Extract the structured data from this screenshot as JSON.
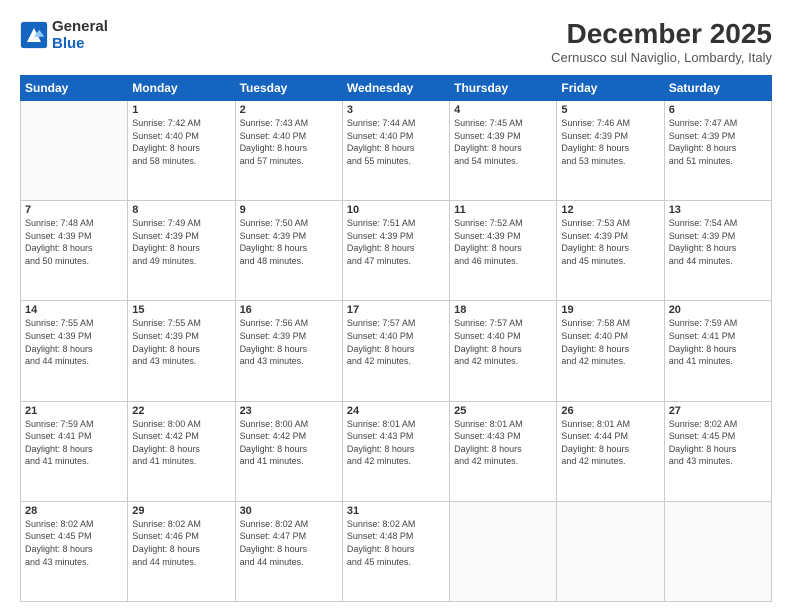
{
  "header": {
    "logo_general": "General",
    "logo_blue": "Blue",
    "title": "December 2025",
    "location": "Cernusco sul Naviglio, Lombardy, Italy"
  },
  "weekdays": [
    "Sunday",
    "Monday",
    "Tuesday",
    "Wednesday",
    "Thursday",
    "Friday",
    "Saturday"
  ],
  "weeks": [
    [
      {
        "day": "",
        "info": ""
      },
      {
        "day": "1",
        "info": "Sunrise: 7:42 AM\nSunset: 4:40 PM\nDaylight: 8 hours\nand 58 minutes."
      },
      {
        "day": "2",
        "info": "Sunrise: 7:43 AM\nSunset: 4:40 PM\nDaylight: 8 hours\nand 57 minutes."
      },
      {
        "day": "3",
        "info": "Sunrise: 7:44 AM\nSunset: 4:40 PM\nDaylight: 8 hours\nand 55 minutes."
      },
      {
        "day": "4",
        "info": "Sunrise: 7:45 AM\nSunset: 4:39 PM\nDaylight: 8 hours\nand 54 minutes."
      },
      {
        "day": "5",
        "info": "Sunrise: 7:46 AM\nSunset: 4:39 PM\nDaylight: 8 hours\nand 53 minutes."
      },
      {
        "day": "6",
        "info": "Sunrise: 7:47 AM\nSunset: 4:39 PM\nDaylight: 8 hours\nand 51 minutes."
      }
    ],
    [
      {
        "day": "7",
        "info": "Sunrise: 7:48 AM\nSunset: 4:39 PM\nDaylight: 8 hours\nand 50 minutes."
      },
      {
        "day": "8",
        "info": "Sunrise: 7:49 AM\nSunset: 4:39 PM\nDaylight: 8 hours\nand 49 minutes."
      },
      {
        "day": "9",
        "info": "Sunrise: 7:50 AM\nSunset: 4:39 PM\nDaylight: 8 hours\nand 48 minutes."
      },
      {
        "day": "10",
        "info": "Sunrise: 7:51 AM\nSunset: 4:39 PM\nDaylight: 8 hours\nand 47 minutes."
      },
      {
        "day": "11",
        "info": "Sunrise: 7:52 AM\nSunset: 4:39 PM\nDaylight: 8 hours\nand 46 minutes."
      },
      {
        "day": "12",
        "info": "Sunrise: 7:53 AM\nSunset: 4:39 PM\nDaylight: 8 hours\nand 45 minutes."
      },
      {
        "day": "13",
        "info": "Sunrise: 7:54 AM\nSunset: 4:39 PM\nDaylight: 8 hours\nand 44 minutes."
      }
    ],
    [
      {
        "day": "14",
        "info": "Sunrise: 7:55 AM\nSunset: 4:39 PM\nDaylight: 8 hours\nand 44 minutes."
      },
      {
        "day": "15",
        "info": "Sunrise: 7:55 AM\nSunset: 4:39 PM\nDaylight: 8 hours\nand 43 minutes."
      },
      {
        "day": "16",
        "info": "Sunrise: 7:56 AM\nSunset: 4:39 PM\nDaylight: 8 hours\nand 43 minutes."
      },
      {
        "day": "17",
        "info": "Sunrise: 7:57 AM\nSunset: 4:40 PM\nDaylight: 8 hours\nand 42 minutes."
      },
      {
        "day": "18",
        "info": "Sunrise: 7:57 AM\nSunset: 4:40 PM\nDaylight: 8 hours\nand 42 minutes."
      },
      {
        "day": "19",
        "info": "Sunrise: 7:58 AM\nSunset: 4:40 PM\nDaylight: 8 hours\nand 42 minutes."
      },
      {
        "day": "20",
        "info": "Sunrise: 7:59 AM\nSunset: 4:41 PM\nDaylight: 8 hours\nand 41 minutes."
      }
    ],
    [
      {
        "day": "21",
        "info": "Sunrise: 7:59 AM\nSunset: 4:41 PM\nDaylight: 8 hours\nand 41 minutes."
      },
      {
        "day": "22",
        "info": "Sunrise: 8:00 AM\nSunset: 4:42 PM\nDaylight: 8 hours\nand 41 minutes."
      },
      {
        "day": "23",
        "info": "Sunrise: 8:00 AM\nSunset: 4:42 PM\nDaylight: 8 hours\nand 41 minutes."
      },
      {
        "day": "24",
        "info": "Sunrise: 8:01 AM\nSunset: 4:43 PM\nDaylight: 8 hours\nand 42 minutes."
      },
      {
        "day": "25",
        "info": "Sunrise: 8:01 AM\nSunset: 4:43 PM\nDaylight: 8 hours\nand 42 minutes."
      },
      {
        "day": "26",
        "info": "Sunrise: 8:01 AM\nSunset: 4:44 PM\nDaylight: 8 hours\nand 42 minutes."
      },
      {
        "day": "27",
        "info": "Sunrise: 8:02 AM\nSunset: 4:45 PM\nDaylight: 8 hours\nand 43 minutes."
      }
    ],
    [
      {
        "day": "28",
        "info": "Sunrise: 8:02 AM\nSunset: 4:45 PM\nDaylight: 8 hours\nand 43 minutes."
      },
      {
        "day": "29",
        "info": "Sunrise: 8:02 AM\nSunset: 4:46 PM\nDaylight: 8 hours\nand 44 minutes."
      },
      {
        "day": "30",
        "info": "Sunrise: 8:02 AM\nSunset: 4:47 PM\nDaylight: 8 hours\nand 44 minutes."
      },
      {
        "day": "31",
        "info": "Sunrise: 8:02 AM\nSunset: 4:48 PM\nDaylight: 8 hours\nand 45 minutes."
      },
      {
        "day": "",
        "info": ""
      },
      {
        "day": "",
        "info": ""
      },
      {
        "day": "",
        "info": ""
      }
    ]
  ]
}
